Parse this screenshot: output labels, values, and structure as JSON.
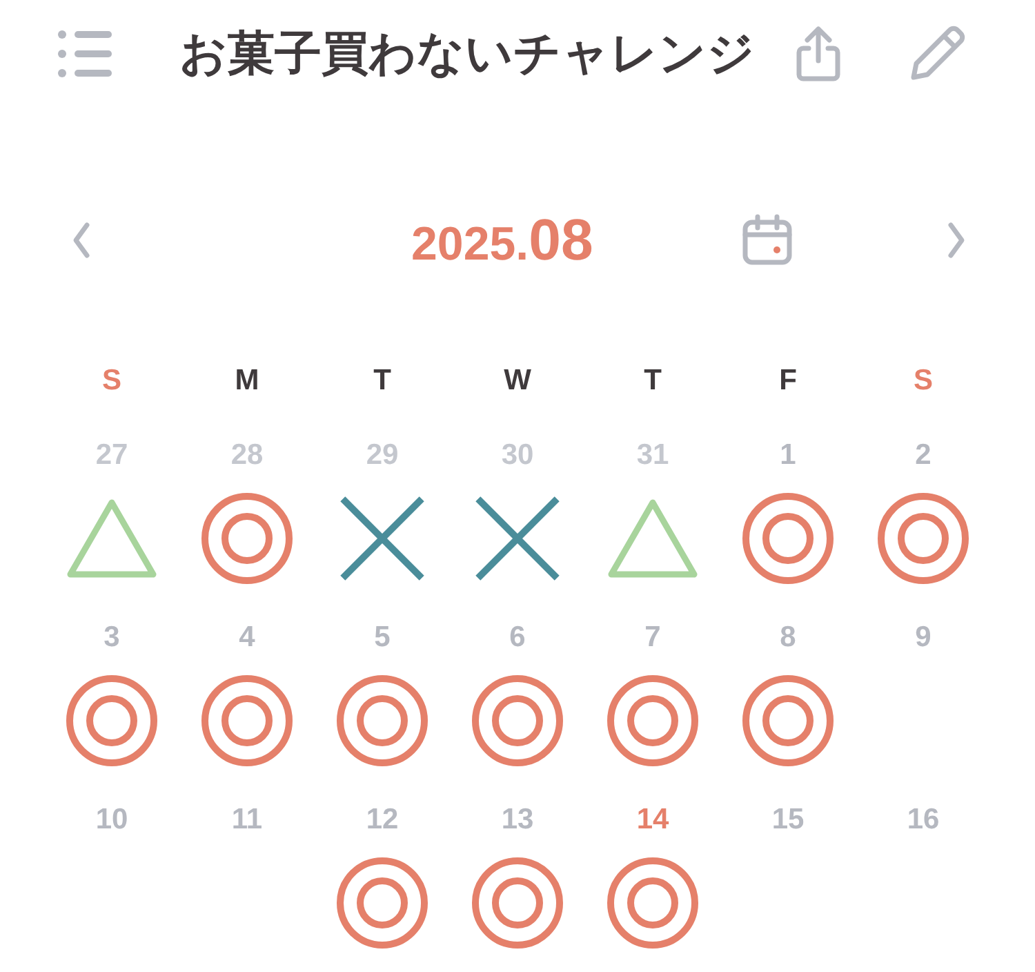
{
  "header": {
    "title": "お菓子買わないチャレンジ"
  },
  "month": {
    "year": "2025.",
    "month": "08"
  },
  "weekdays": [
    {
      "label": "S",
      "weekend": true
    },
    {
      "label": "M",
      "weekend": false
    },
    {
      "label": "T",
      "weekend": false
    },
    {
      "label": "W",
      "weekend": false
    },
    {
      "label": "T",
      "weekend": false
    },
    {
      "label": "F",
      "weekend": false
    },
    {
      "label": "S",
      "weekend": true
    }
  ],
  "days": [
    {
      "day": "27",
      "other_month": true,
      "today": false,
      "kind": "triangle"
    },
    {
      "day": "28",
      "other_month": true,
      "today": false,
      "kind": "double-circle"
    },
    {
      "day": "29",
      "other_month": true,
      "today": false,
      "kind": "cross"
    },
    {
      "day": "30",
      "other_month": true,
      "today": false,
      "kind": "cross"
    },
    {
      "day": "31",
      "other_month": true,
      "today": false,
      "kind": "triangle"
    },
    {
      "day": "1",
      "other_month": false,
      "today": false,
      "kind": "double-circle"
    },
    {
      "day": "2",
      "other_month": false,
      "today": false,
      "kind": "double-circle"
    },
    {
      "day": "3",
      "other_month": false,
      "today": false,
      "kind": "double-circle"
    },
    {
      "day": "4",
      "other_month": false,
      "today": false,
      "kind": "double-circle"
    },
    {
      "day": "5",
      "other_month": false,
      "today": false,
      "kind": "double-circle"
    },
    {
      "day": "6",
      "other_month": false,
      "today": false,
      "kind": "double-circle"
    },
    {
      "day": "7",
      "other_month": false,
      "today": false,
      "kind": "double-circle"
    },
    {
      "day": "8",
      "other_month": false,
      "today": false,
      "kind": "double-circle"
    },
    {
      "day": "9",
      "other_month": false,
      "today": false,
      "kind": "none"
    },
    {
      "day": "10",
      "other_month": false,
      "today": false,
      "kind": "none"
    },
    {
      "day": "11",
      "other_month": false,
      "today": false,
      "kind": "none"
    },
    {
      "day": "12",
      "other_month": false,
      "today": false,
      "kind": "double-circle"
    },
    {
      "day": "13",
      "other_month": false,
      "today": false,
      "kind": "double-circle"
    },
    {
      "day": "14",
      "other_month": false,
      "today": true,
      "kind": "double-circle"
    },
    {
      "day": "15",
      "other_month": false,
      "today": false,
      "kind": "none"
    },
    {
      "day": "16",
      "other_month": false,
      "today": false,
      "kind": "none"
    }
  ]
}
